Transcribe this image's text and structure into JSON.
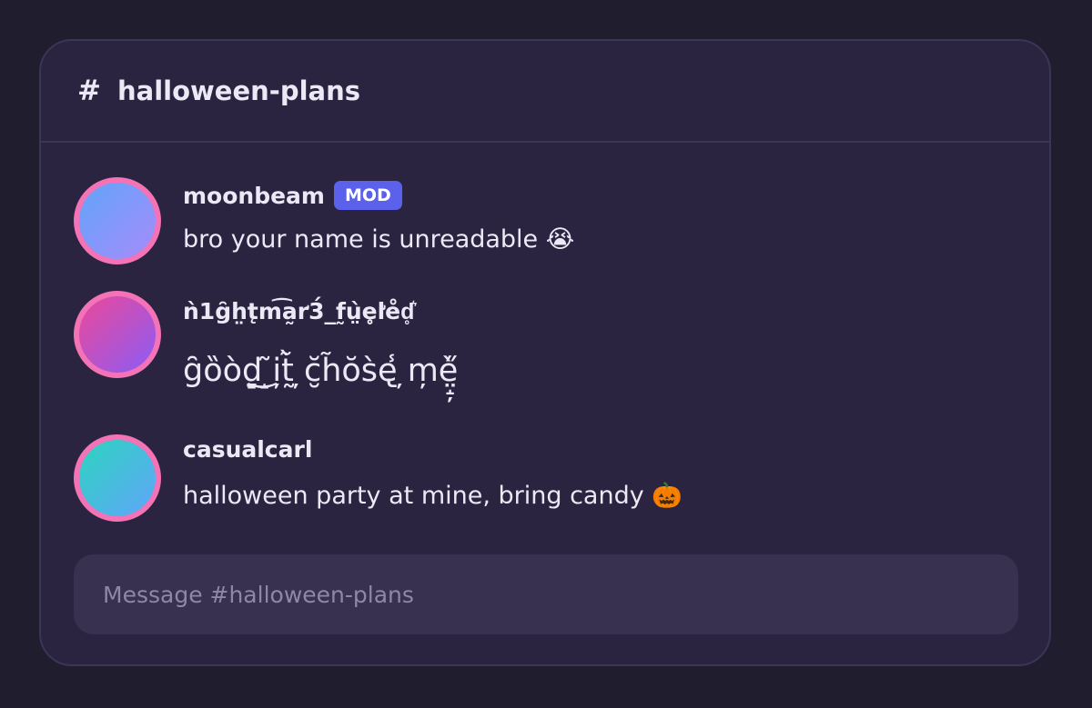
{
  "channel": {
    "hash": "#",
    "name": "halloween-plans"
  },
  "messages": [
    {
      "username": "moonbeam",
      "badge": "MOD",
      "text": "bro your name is unreadable 😭",
      "avatar_gradient": [
        "#60a5fa",
        "#a78bfa"
      ]
    },
    {
      "username": "ǹ1g̑h̤t̨m͡a̰r̛3́_f̰ṳ̀e̥l̛e̊d̥͛",
      "badge": "",
      "text": "g̑ȍòd̦̞̤̝̦͜ ̝͂i̦t̰̃̀ ̦c̮̆h̃ŏs̀e̢̾ ̦m̦è̤̝̦̋",
      "avatar_gradient": [
        "#ec4899",
        "#8b5cf6"
      ]
    },
    {
      "username": "casualcarl",
      "badge": "",
      "text": "halloween party at mine, bring candy 🎃",
      "avatar_gradient": [
        "#2dd4bf",
        "#60a5fa"
      ]
    }
  ],
  "composer": {
    "placeholder": "Message #halloween-plans",
    "value": ""
  },
  "colors": {
    "background": "#1f1d2e",
    "panel": "#2a2440",
    "avatar_ring": "#f472b6",
    "mod_badge": "#5b61ea",
    "composer": "#383150"
  }
}
